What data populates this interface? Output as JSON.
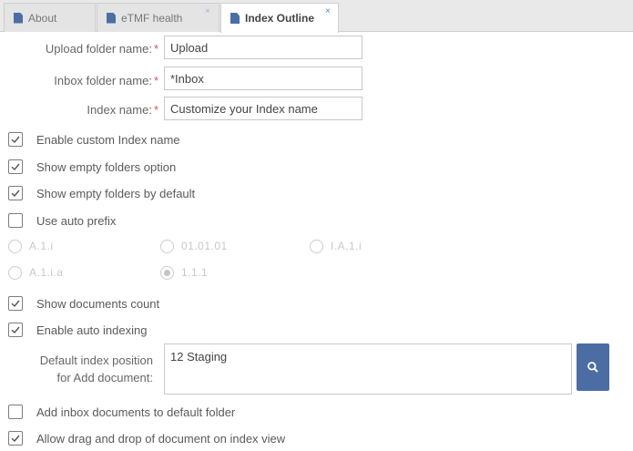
{
  "tabs": [
    {
      "label": "About",
      "icon": "document-icon",
      "closable": false
    },
    {
      "label": "eTMF health",
      "icon": "document-icon",
      "closable": true
    },
    {
      "label": "Index Outline",
      "icon": "document-icon",
      "closable": true,
      "active": true
    }
  ],
  "tab_close_glyph": "×",
  "form": {
    "upload_label": "Upload folder name:",
    "upload_value": "Upload",
    "inbox_label": "Inbox folder name:",
    "inbox_value": "*Inbox",
    "index_label": "Index name:",
    "index_value": "Customize your Index name",
    "required_mark": "*"
  },
  "options": [
    {
      "label": "Enable custom Index name",
      "checked": true
    },
    {
      "label": "Show empty folders option",
      "checked": true
    },
    {
      "label": "Show empty folders by default",
      "checked": true
    },
    {
      "label": "Use auto prefix",
      "checked": false
    }
  ],
  "prefix_formats": [
    {
      "label": "A.1.i",
      "selected": false
    },
    {
      "label": "01.01.01",
      "selected": false
    },
    {
      "label": "I.A.1.i",
      "selected": false
    },
    {
      "label": "A.1.i.a",
      "selected": false
    },
    {
      "label": "1.1.1",
      "selected": true
    }
  ],
  "options2": [
    {
      "label": "Show documents count",
      "checked": true
    },
    {
      "label": "Enable auto indexing",
      "checked": true
    }
  ],
  "default_position": {
    "label_line1": "Default index position",
    "label_line2": "for Add document:",
    "value": "12 Staging",
    "search_icon": "search-icon"
  },
  "options3": [
    {
      "label": "Add inbox documents to default folder",
      "checked": false
    },
    {
      "label": "Allow drag and drop of document on index view",
      "checked": true
    }
  ],
  "colors": {
    "accent": "#4c6ca4",
    "required": "#d9534f",
    "tab_bar": "#e9e9e9"
  }
}
